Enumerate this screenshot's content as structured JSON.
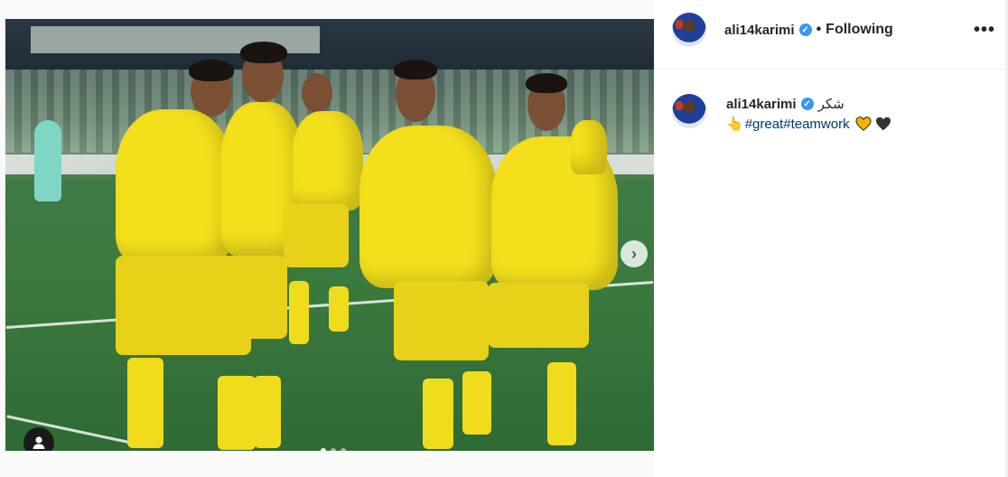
{
  "post": {
    "username": "ali14karimi",
    "following_label": "Following",
    "more_label": "•••",
    "media": {
      "carousel_next": "›",
      "slide_count": 3,
      "active_slide": 1
    }
  },
  "caption": {
    "username": "ali14karimi",
    "text": "شکر",
    "pointing_emoji": "👆",
    "hashtags": [
      "#great",
      "#teamwork"
    ],
    "hearts": [
      {
        "name": "yellow-heart",
        "color": "#f5b400"
      },
      {
        "name": "black-heart",
        "color": "#333333"
      }
    ]
  },
  "colors": {
    "verified": "#3897f0",
    "hashtag": "#00376b"
  },
  "icons": {
    "verified": "verified-badge-icon",
    "more": "more-options-icon",
    "user_tag": "user-tag-icon",
    "next": "chevron-right-icon"
  }
}
